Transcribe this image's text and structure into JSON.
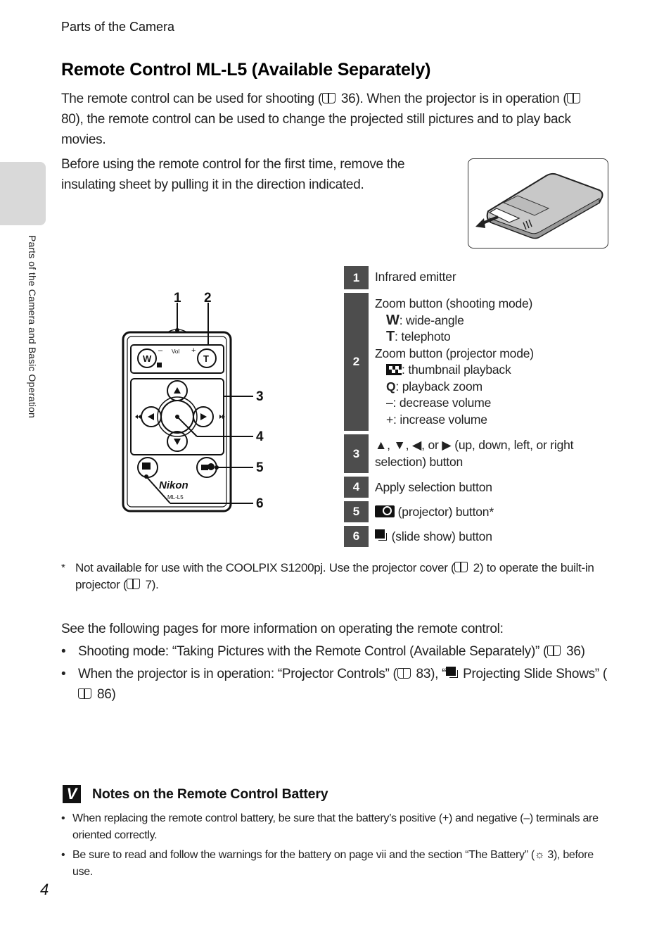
{
  "running_head": "Parts of the Camera",
  "side_tab_label": "Parts of the Camera and Basic Operation",
  "title": "Remote Control ML-L5 (Available Separately)",
  "intro": {
    "p1_a": "The remote control can be used for shooting (",
    "p1_b": " 36). When the projector is in operation (",
    "p1_c": " 80), the remote control can be used to change the projected still pictures and to play back movies.",
    "p2": "Before using the remote control for the first time, remove the insulating sheet by pulling it in the direction indicated."
  },
  "remote_callouts": [
    "1",
    "2",
    "3",
    "4",
    "5",
    "6"
  ],
  "remote_labels": {
    "w": "W",
    "t": "T",
    "vol": "Vol",
    "minus": "–",
    "plus": "+",
    "brand": "Nikon",
    "model": "ML-L5"
  },
  "legend": [
    {
      "num": "1",
      "text": "Infrared emitter"
    },
    {
      "num": "2",
      "lines": [
        {
          "indent": false,
          "text": "Zoom button (shooting mode)"
        },
        {
          "indent": true,
          "symbol": "W",
          "text": ": wide-angle"
        },
        {
          "indent": true,
          "symbol": "T",
          "text": ": telephoto"
        },
        {
          "indent": false,
          "text": "Zoom button (projector mode)"
        },
        {
          "indent": true,
          "icon": "thumbnail-icon",
          "text": ": thumbnail playback"
        },
        {
          "indent": true,
          "icon": "magnifier-icon",
          "text": ": playback zoom"
        },
        {
          "indent": true,
          "text": "–: decrease volume"
        },
        {
          "indent": true,
          "text": "+: increase volume"
        }
      ]
    },
    {
      "num": "3",
      "text": "▲, ▼, ◀, or ▶ (up, down, left, or right selection) button"
    },
    {
      "num": "4",
      "text": "Apply selection button"
    },
    {
      "num": "5",
      "text": " (projector) button*"
    },
    {
      "num": "6",
      "text": " (slide show) button"
    }
  ],
  "footnote": {
    "star": "*",
    "a": "Not available for use with the COOLPIX S1200pj. Use the projector cover (",
    "b": " 2) to operate the built-in projector (",
    "c": " 7)."
  },
  "more_info": "See the following pages for more information on operating the remote control:",
  "bullets": {
    "b1_a": "Shooting mode: “Taking Pictures with the Remote Control (Available Separately)” (",
    "b1_b": " 36)",
    "b2_a": "When the projector is in operation: “Projector Controls” (",
    "b2_b": " 83), “",
    "b2_c": " Projecting Slide Shows” (",
    "b2_d": " 86)"
  },
  "notes": {
    "icon": "V",
    "title": "Notes on the Remote Control Battery",
    "items": [
      "When replacing the remote control battery, be sure that the battery’s positive (+) and negative (–) terminals are oriented correctly.",
      "Be sure to read and follow the warnings for the battery on page vii and the section “The Battery” (☼ 3), before use."
    ]
  },
  "page_number": "4"
}
